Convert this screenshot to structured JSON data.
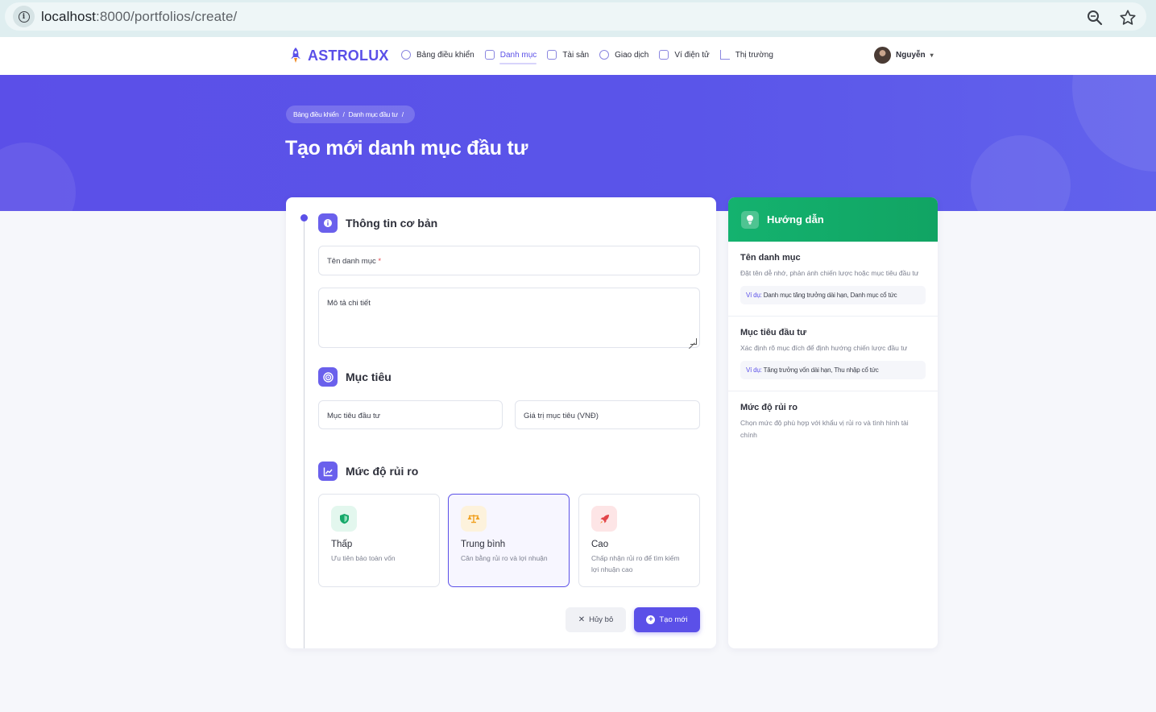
{
  "browser": {
    "url_host": "localhost",
    "url_path": ":8000/portfolios/create/"
  },
  "brand": {
    "name": "ASTROLUX",
    "color": "#5b50e8"
  },
  "nav": {
    "items": [
      {
        "label": "Bảng điều khiển",
        "icon": "dashboard-icon",
        "active": false
      },
      {
        "label": "Danh mục",
        "icon": "portfolio-icon",
        "active": true
      },
      {
        "label": "Tài sản",
        "icon": "asset-icon",
        "active": false
      },
      {
        "label": "Giao dịch",
        "icon": "transaction-icon",
        "active": false
      },
      {
        "label": "Ví điện tử",
        "icon": "wallet-icon",
        "active": false
      },
      {
        "label": "Thị trường",
        "icon": "market-icon",
        "active": false
      }
    ],
    "user_name": "Nguyễn"
  },
  "hero": {
    "breadcrumb": [
      "Bảng điều khiển",
      "Danh mục đầu tư"
    ],
    "breadcrumb_sep": "/",
    "title": "Tạo mới danh mục đầu tư"
  },
  "form": {
    "sections": {
      "basic": "Thông tin cơ bản",
      "goal": "Mục tiêu",
      "risk": "Mức độ rủi ro"
    },
    "fields": {
      "name_label": "Tên danh mục",
      "name_required": "*",
      "description_label": "Mô tả chi tiết",
      "goal_label": "Mục tiêu đầu tư",
      "target_value_label": "Giá trị mục tiêu (VNĐ)"
    },
    "risk_options": [
      {
        "title": "Thấp",
        "desc": "Ưu tiên bảo toàn vốn",
        "icon": "shield-icon",
        "color": "#16a86a",
        "bg": "#e3f7ee",
        "selected": false
      },
      {
        "title": "Trung bình",
        "desc": "Cân bằng rủi ro và lợi nhuận",
        "icon": "scale-icon",
        "color": "#f0a020",
        "bg": "#fdf2dc",
        "selected": true
      },
      {
        "title": "Cao",
        "desc": "Chấp nhận rủi ro để tìm kiếm lợi nhuận cao",
        "icon": "rocket-icon",
        "color": "#e2454a",
        "bg": "#fde5e6",
        "selected": false
      }
    ],
    "cancel_label": "Hủy bỏ",
    "submit_label": "Tạo mới"
  },
  "guide": {
    "title": "Hướng dẫn",
    "sections": [
      {
        "title": "Tên danh mục",
        "desc": "Đặt tên dễ nhớ, phản ánh chiến lược hoặc mục tiêu đầu tư",
        "example_label": "Ví dụ:",
        "example": " Danh mục tăng trưởng dài hạn, Danh mục cổ tức"
      },
      {
        "title": "Mục tiêu đầu tư",
        "desc": "Xác định rõ mục đích để định hướng chiến lược đầu tư",
        "example_label": "Ví dụ:",
        "example": " Tăng trưởng vốn dài hạn, Thu nhập cổ tức"
      },
      {
        "title": "Mức độ rủi ro",
        "desc": "Chọn mức độ phù hợp với khẩu vị rủi ro và tình hình tài chính"
      }
    ]
  },
  "colors": {
    "primary": "#5b50e8",
    "hero_bg": "#5a55e9",
    "guide_header": "#14b26f"
  }
}
